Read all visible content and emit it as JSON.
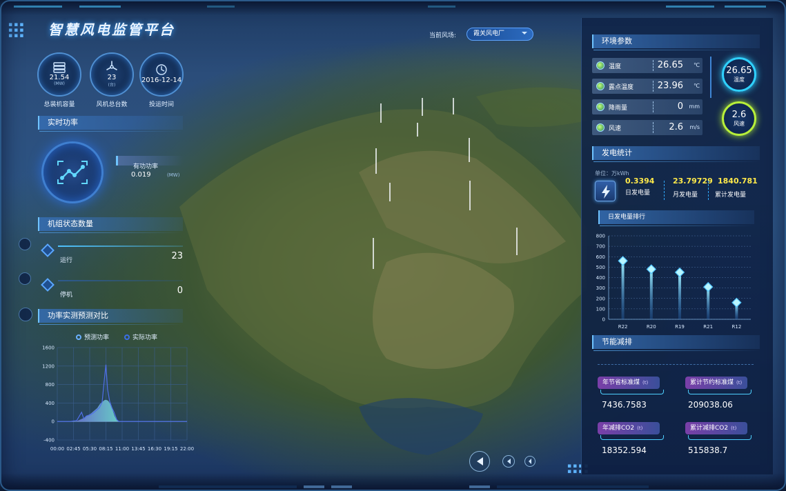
{
  "title": "智慧风电监管平台",
  "selector": {
    "label": "当前风场:",
    "value": "霞关风电厂"
  },
  "kpis": [
    {
      "value": "21.54",
      "unit": "(MW)",
      "label": "总装机容量",
      "icon": "server-icon"
    },
    {
      "value": "23",
      "unit": "(台)",
      "label": "风机总台数",
      "icon": "wind-turbine-icon"
    },
    {
      "value": "2016-12-14",
      "unit": "",
      "label": "投运时间",
      "icon": "clock-icon"
    }
  ],
  "realtime": {
    "section": "实时功率",
    "label": "有功功率",
    "value": "0.019",
    "unit": "(MW)"
  },
  "status": {
    "section": "机组状态数量",
    "items": [
      {
        "label": "运行",
        "value": "23"
      },
      {
        "label": "停机",
        "value": "0"
      }
    ]
  },
  "forecast": {
    "section": "功率实测预测对比",
    "legend": [
      "预测功率",
      "实际功率"
    ],
    "chart_data": {
      "type": "area",
      "title": "",
      "xlabel": "",
      "ylabel": "",
      "x": [
        "00:00",
        "02:45",
        "05:30",
        "08:15",
        "11:00",
        "13:45",
        "16:30",
        "19:15",
        "22:00"
      ],
      "ylim": [
        -400,
        1600
      ],
      "yticks": [
        -400,
        0,
        400,
        800,
        1200,
        1600
      ],
      "series": [
        {
          "name": "预测功率",
          "points": [
            [
              0,
              0
            ],
            [
              2.4,
              0
            ],
            [
              3.6,
              20
            ],
            [
              4.5,
              200
            ],
            [
              4.9,
              60
            ],
            [
              5.4,
              120
            ],
            [
              6.0,
              140
            ],
            [
              6.6,
              180
            ],
            [
              7.2,
              240
            ],
            [
              7.8,
              300
            ],
            [
              8.3,
              420
            ],
            [
              8.7,
              900
            ],
            [
              9.0,
              1230
            ],
            [
              9.3,
              700
            ],
            [
              9.7,
              430
            ],
            [
              10.1,
              300
            ],
            [
              10.5,
              200
            ],
            [
              11.0,
              40
            ],
            [
              11.4,
              0
            ],
            [
              24,
              0
            ]
          ]
        },
        {
          "name": "实际功率",
          "points": [
            [
              0,
              0
            ],
            [
              3.4,
              0
            ],
            [
              4.0,
              30
            ],
            [
              5.0,
              80
            ],
            [
              5.6,
              130
            ],
            [
              6.2,
              170
            ],
            [
              6.8,
              230
            ],
            [
              7.4,
              290
            ],
            [
              7.9,
              380
            ],
            [
              8.3,
              420
            ],
            [
              8.7,
              460
            ],
            [
              9.0,
              470
            ],
            [
              9.4,
              450
            ],
            [
              9.8,
              380
            ],
            [
              10.2,
              260
            ],
            [
              10.6,
              120
            ],
            [
              11.0,
              30
            ],
            [
              11.4,
              0
            ],
            [
              24,
              0
            ]
          ]
        }
      ]
    }
  },
  "environment": {
    "section": "环境参数",
    "rows": [
      {
        "label": "温度",
        "value": "26.65",
        "unit": "℃"
      },
      {
        "label": "露点温度",
        "value": "23.96",
        "unit": "℃"
      },
      {
        "label": "降雨量",
        "value": "0",
        "unit": "mm"
      },
      {
        "label": "风速",
        "value": "2.6",
        "unit": "m/s"
      }
    ],
    "gauges": [
      {
        "value": "26.65",
        "label": "温度",
        "color": "#2fd1ff"
      },
      {
        "value": "2.6",
        "label": "风速",
        "color": "#b7ef3a"
      }
    ]
  },
  "generation": {
    "section": "发电统计",
    "unit_label": "单位：万kWh",
    "items": [
      {
        "value": "0.3394",
        "label": "日发电量"
      },
      {
        "value": "23.79729",
        "label": "月发电量"
      },
      {
        "value": "1840.781",
        "label": "累计发电量"
      }
    ]
  },
  "ranking": {
    "section": "日发电量排行",
    "chart_data": {
      "type": "bar",
      "title": "",
      "categories": [
        "R22",
        "R20",
        "R19",
        "R21",
        "R12"
      ],
      "values": [
        560,
        480,
        450,
        310,
        160
      ],
      "ylim": [
        0,
        800
      ],
      "yticks": [
        0,
        100,
        200,
        300,
        400,
        500,
        600,
        700,
        800
      ]
    }
  },
  "energy_saving": {
    "section": "节能减排",
    "items": [
      {
        "label": "年节省标准煤",
        "unit": "(t)",
        "value": "7436.7583"
      },
      {
        "label": "累计节约标准煤",
        "unit": "(t)",
        "value": "209038.06"
      },
      {
        "label": "年减排CO2",
        "unit": "(t)",
        "value": "18352.594"
      },
      {
        "label": "累计减排CO2",
        "unit": "(t)",
        "value": "515838.7"
      }
    ]
  },
  "colors": {
    "accent": "#4fc3ff",
    "yellow": "#ffe94a",
    "purple": "#7a3fa8"
  }
}
